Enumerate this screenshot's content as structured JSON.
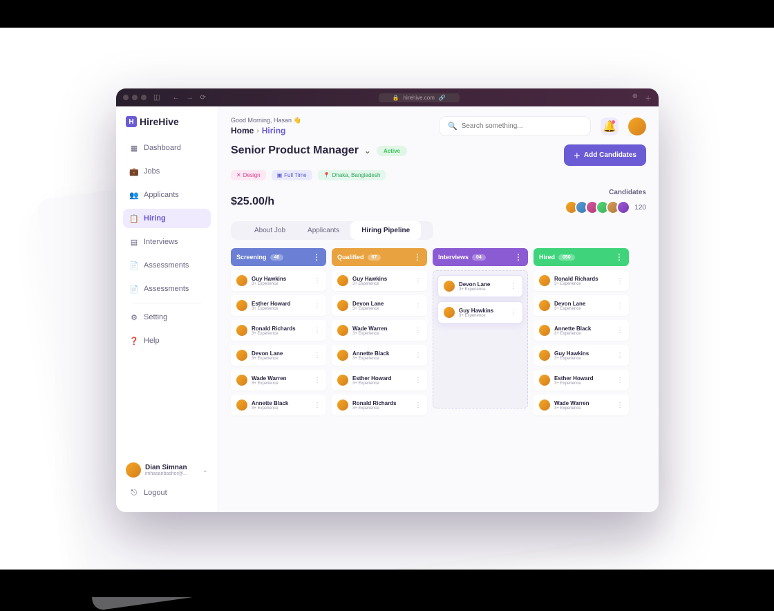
{
  "browser": {
    "url": "hirehive.com"
  },
  "brand": {
    "name": "HireHive",
    "logo_letter": "H"
  },
  "sidebar": {
    "items": [
      {
        "label": "Dashboard",
        "icon": "grid-icon"
      },
      {
        "label": "Jobs",
        "icon": "briefcase-icon"
      },
      {
        "label": "Applicants",
        "icon": "users-icon"
      },
      {
        "label": "Hiring",
        "icon": "clipboard-icon",
        "active": true
      },
      {
        "label": "Interviews",
        "icon": "calendar-icon"
      },
      {
        "label": "Assessments",
        "icon": "file-icon"
      },
      {
        "label": "Assessments",
        "icon": "file-icon"
      },
      {
        "label": "Setting",
        "icon": "gear-icon"
      },
      {
        "label": "Help",
        "icon": "help-icon"
      }
    ],
    "user": {
      "name": "Dian Simnan",
      "email": "imhasanbashor@..."
    },
    "logout_label": "Logout"
  },
  "topbar": {
    "greeting": "Good Morning, Hasan 👋",
    "breadcrumbs": [
      "Home",
      "Hiring"
    ],
    "search_placeholder": "Search something..."
  },
  "job": {
    "title": "Senior Product Manager",
    "status": "Active",
    "chips": {
      "design": "Design",
      "fulltime": "Full Time",
      "location": "Dhaka, Bangladesh"
    },
    "rate": "$25.00/h",
    "add_button": "Add Candidates",
    "candidates_label": "Candidates",
    "candidates_count": "120"
  },
  "tabs": [
    "About Job",
    "Applicants",
    "Hiring Pipeline"
  ],
  "active_tab": 2,
  "pipeline": {
    "columns": [
      {
        "title": "Screening",
        "count": "40",
        "style": "screening",
        "cards": [
          {
            "name": "Guy Hawkins",
            "sub": "3+ Experience"
          },
          {
            "name": "Esther Howard",
            "sub": "3+ Experience"
          },
          {
            "name": "Ronald Richards",
            "sub": "3+ Experience"
          },
          {
            "name": "Devon Lane",
            "sub": "3+ Experience"
          },
          {
            "name": "Wade Warren",
            "sub": "3+ Experience"
          },
          {
            "name": "Annette Black",
            "sub": "3+ Experience"
          }
        ]
      },
      {
        "title": "Qualified",
        "count": "67",
        "style": "qualified",
        "cards": [
          {
            "name": "Guy Hawkins",
            "sub": "3+ Experience"
          },
          {
            "name": "Devon Lane",
            "sub": "3+ Experience"
          },
          {
            "name": "Wade Warren",
            "sub": "3+ Experience"
          },
          {
            "name": "Annette Black",
            "sub": "3+ Experience"
          },
          {
            "name": "Esther Howard",
            "sub": "3+ Experience"
          },
          {
            "name": "Ronald Richards",
            "sub": "3+ Experience"
          }
        ]
      },
      {
        "title": "Interviews",
        "count": "04",
        "style": "interviews",
        "drop": true,
        "cards": [
          {
            "name": "Devon Lane",
            "sub": "3+ Experience"
          },
          {
            "name": "Guy Hawkins",
            "sub": "3+ Experience"
          }
        ]
      },
      {
        "title": "Hired",
        "count": "050",
        "style": "hired",
        "cards": [
          {
            "name": "Ronald Richards",
            "sub": "3+ Experience"
          },
          {
            "name": "Devon Lane",
            "sub": "3+ Experience"
          },
          {
            "name": "Annette Black",
            "sub": "3+ Experience"
          },
          {
            "name": "Guy Hawkins",
            "sub": "3+ Experience"
          },
          {
            "name": "Esther Howard",
            "sub": "3+ Experience"
          },
          {
            "name": "Wade Warren",
            "sub": "3+ Experience"
          }
        ]
      }
    ]
  }
}
